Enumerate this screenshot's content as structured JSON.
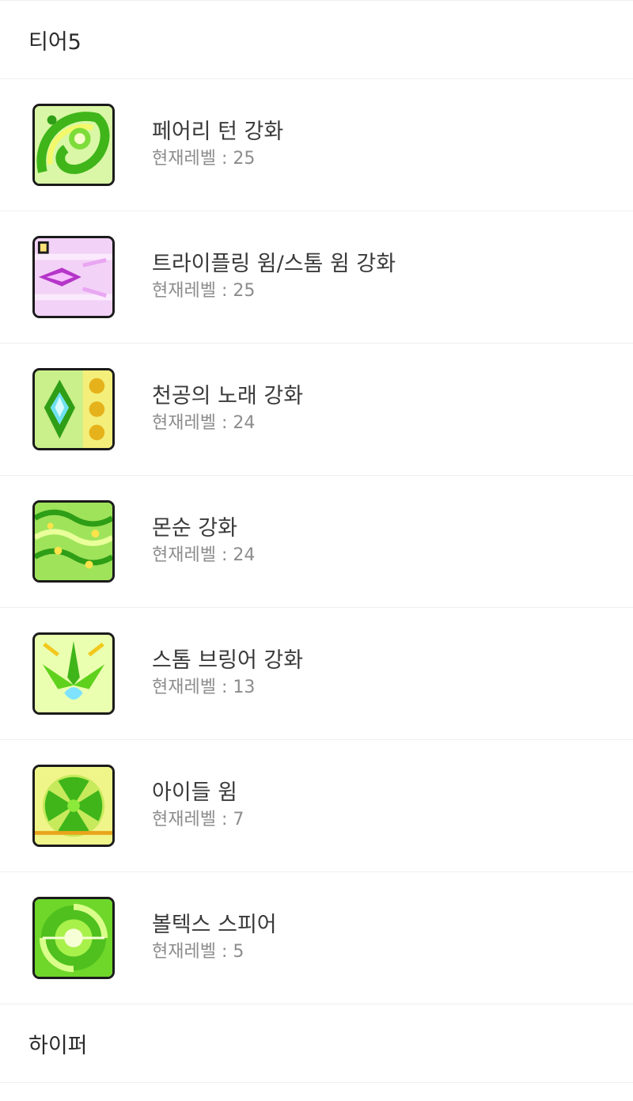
{
  "tier_header": {
    "label": "티어5"
  },
  "skills": [
    {
      "name": "페어리 턴 강화",
      "level_prefix": "현재레벨 : ",
      "level": "25",
      "icon": "fairy-turn-icon"
    },
    {
      "name": "트라이플링 윔/스톰 윔 강화",
      "level_prefix": "현재레벨 : ",
      "level": "25",
      "icon": "trifling-whim-icon"
    },
    {
      "name": "천공의 노래 강화",
      "level_prefix": "현재레벨 : ",
      "level": "24",
      "icon": "song-of-heaven-icon"
    },
    {
      "name": "몬순 강화",
      "level_prefix": "현재레벨 : ",
      "level": "24",
      "icon": "monsoon-icon"
    },
    {
      "name": "스톰 브링어 강화",
      "level_prefix": "현재레벨 : ",
      "level": "13",
      "icon": "storm-bringer-icon"
    },
    {
      "name": "아이들 윔",
      "level_prefix": "현재레벨 : ",
      "level": "7",
      "icon": "idle-whim-icon"
    },
    {
      "name": "볼텍스 스피어",
      "level_prefix": "현재레벨 : ",
      "level": "5",
      "icon": "vortex-sphere-icon"
    }
  ],
  "next_header": {
    "label": "하이퍼"
  },
  "colors": {
    "divider": "#efefef",
    "name_text": "#3a3a3a",
    "level_text": "#8c8c8c",
    "icon_green": "#5fd11c",
    "icon_pink": "#e7a6ee"
  }
}
